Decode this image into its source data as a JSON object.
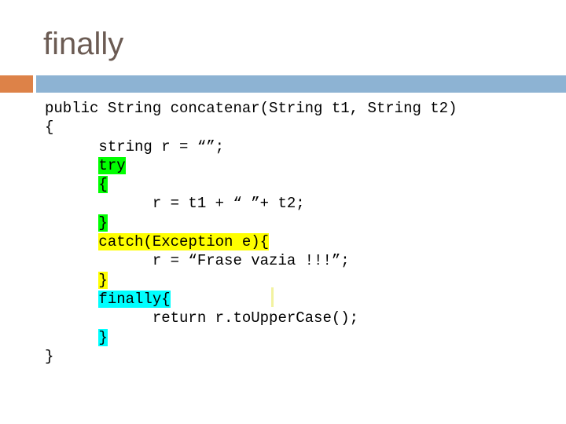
{
  "slide": {
    "title": "finally",
    "title_color": "#6b5b53",
    "accent_color": "#dd8248",
    "bar_color": "#8db3d3",
    "background": "#ffffff"
  },
  "highlight_colors": {
    "green": "#00ff00",
    "yellow": "#ffff00",
    "cyan": "#00ffff",
    "caret": "#f2f2a0"
  },
  "code": {
    "language": "java",
    "lines": [
      {
        "indent": "",
        "text": "public String concatenar(String t1, String t2)",
        "highlight": "none"
      },
      {
        "indent": "",
        "text": "{",
        "highlight": "none"
      },
      {
        "indent": "      ",
        "text": "string r = “”;",
        "highlight": "none"
      },
      {
        "indent": "      ",
        "text": "try",
        "highlight": "green"
      },
      {
        "indent": "      ",
        "text": "{",
        "highlight": "green"
      },
      {
        "indent": "            ",
        "text": "r = t1 + “ ”+ t2;",
        "highlight": "none"
      },
      {
        "indent": "      ",
        "text": "}",
        "highlight": "green"
      },
      {
        "indent": "      ",
        "text": "catch(Exception e){",
        "highlight": "yellow"
      },
      {
        "indent": "            ",
        "text": "r = “Frase vazia !!!”;",
        "highlight": "none"
      },
      {
        "indent": "      ",
        "text": "}",
        "highlight": "yellow"
      },
      {
        "indent": "      ",
        "text": "finally{",
        "highlight": "cyan"
      },
      {
        "indent": "            ",
        "text": "return r.toUpperCase();",
        "highlight": "none"
      },
      {
        "indent": "      ",
        "text": "}",
        "highlight": "cyan"
      },
      {
        "indent": "",
        "text": "}",
        "highlight": "none"
      }
    ]
  }
}
